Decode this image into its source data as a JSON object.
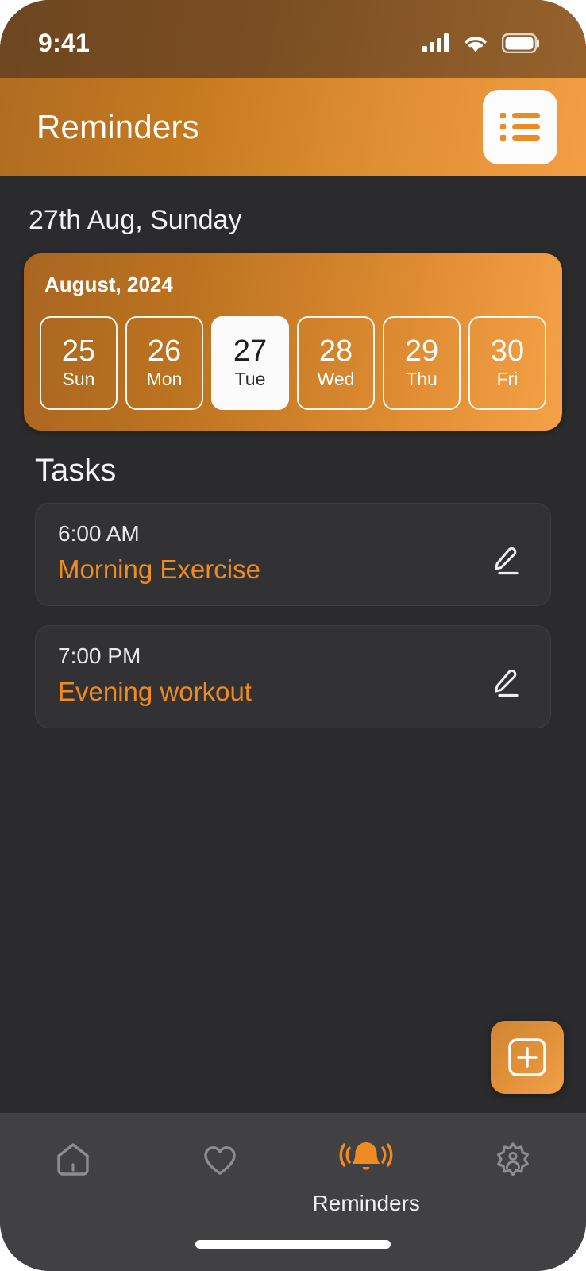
{
  "status_bar": {
    "time": "9:41",
    "icons": [
      "signal-icon",
      "wifi-icon",
      "battery-icon"
    ]
  },
  "header": {
    "title": "Reminders",
    "list_button_icon": "list-icon"
  },
  "main": {
    "date_heading": "27th Aug, Sunday",
    "calendar": {
      "month_label": "August, 2024",
      "days": [
        {
          "num": "25",
          "name": "Sun",
          "selected": false
        },
        {
          "num": "26",
          "name": "Mon",
          "selected": false
        },
        {
          "num": "27",
          "name": "Tue",
          "selected": true
        },
        {
          "num": "28",
          "name": "Wed",
          "selected": false
        },
        {
          "num": "29",
          "name": "Thu",
          "selected": false
        },
        {
          "num": "30",
          "name": "Fri",
          "selected": false
        }
      ]
    },
    "tasks_heading": "Tasks",
    "tasks": [
      {
        "time": "6:00 AM",
        "title": "Morning Exercise",
        "edit_icon": "pencil-edit-icon"
      },
      {
        "time": "7:00 PM",
        "title": "Evening workout",
        "edit_icon": "pencil-edit-icon"
      }
    ],
    "add_button_icon": "plus-square-icon"
  },
  "bottom_nav": {
    "items": [
      {
        "icon": "home-icon",
        "label": "",
        "active": false
      },
      {
        "icon": "heart-icon",
        "label": "",
        "active": false
      },
      {
        "icon": "bell-ringing-icon",
        "label": "Reminders",
        "active": true
      },
      {
        "icon": "gear-icon",
        "label": "",
        "active": false
      }
    ]
  },
  "colors": {
    "accent_orange": "#ef8b21",
    "header_gradient_start": "#b06c22",
    "header_gradient_end": "#f39e44",
    "background_dark": "#2b2b2d",
    "card_dark": "#323234",
    "nav_background": "#414144"
  }
}
